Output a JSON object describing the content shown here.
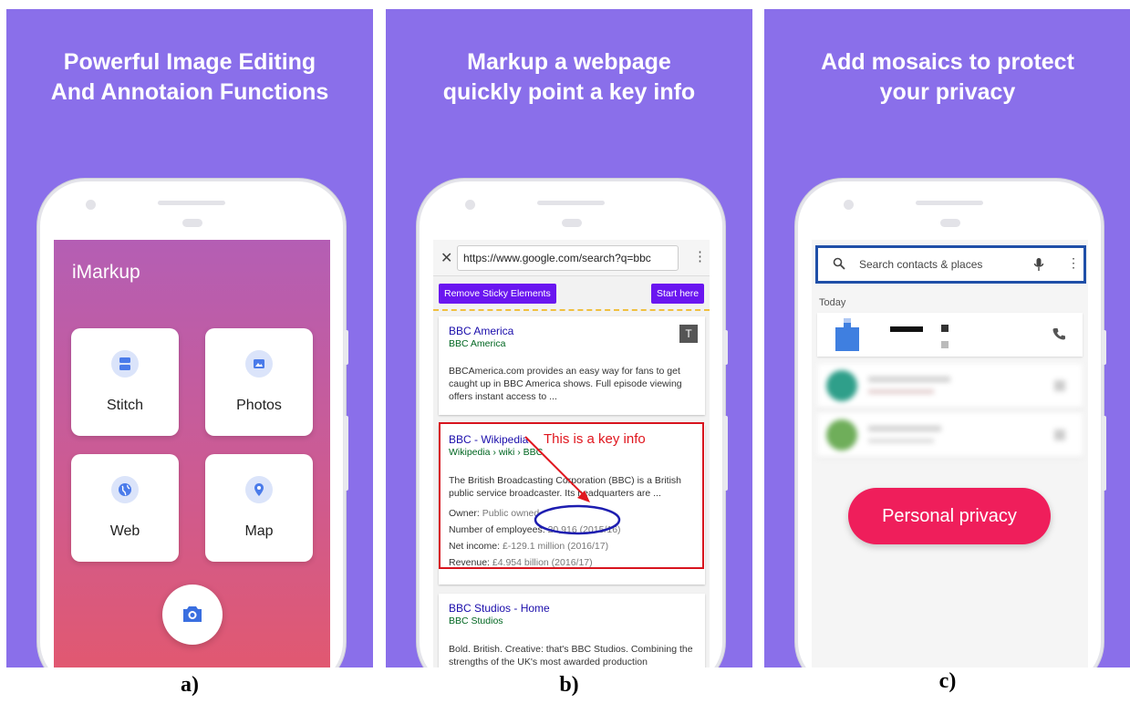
{
  "panels": [
    {
      "heading_line1": "Powerful Image Editing",
      "heading_line2": "And Annotaion Functions",
      "caption": "a)"
    },
    {
      "heading_line1": "Markup a webpage",
      "heading_line2": "quickly point a key info",
      "caption": "b)"
    },
    {
      "heading_line1": "Add mosaics to protect",
      "heading_line2": "your privacy",
      "caption": "c)"
    }
  ],
  "imarkup": {
    "app_title": "iMarkup",
    "tiles": [
      {
        "label": "Stitch",
        "icon": "stitch-icon"
      },
      {
        "label": "Photos",
        "icon": "image-icon"
      },
      {
        "label": "Web",
        "icon": "globe-icon"
      },
      {
        "label": "Map",
        "icon": "map-pin-icon"
      }
    ],
    "camera_icon": "camera-icon"
  },
  "browser": {
    "url": "https://www.google.com/search?q=bbc",
    "remove_sticky": "Remove Sticky Elements",
    "start_here": "Start here",
    "results": [
      {
        "title": "BBC America",
        "source": "BBC America",
        "desc": "BBCAmerica.com provides an easy way for fans to get caught up in BBC America shows. Full episode viewing offers instant access to ...",
        "button": "T"
      },
      {
        "title": "BBC - Wikipedia",
        "source": "Wikipedia › wiki › BBC",
        "desc": "The British Broadcasting Corporation (BBC) is a British public service broadcaster. Its headquarters are ...",
        "facts": [
          {
            "label": "Owner:",
            "value": "Public owned"
          },
          {
            "label": "Number of employees:",
            "value": "20,916 (2015/16)"
          },
          {
            "label": "Net income:",
            "value": "£-129.1 million (2016/17)"
          },
          {
            "label": "Revenue:",
            "value": "£4.954 billion (2016/17)"
          }
        ]
      },
      {
        "title": "BBC Studios - Home",
        "source": "BBC Studios",
        "desc": "Bold. British. Creative: that's BBC Studios. Combining the strengths of the UK's most awarded production"
      }
    ],
    "annotation": "This is a key info",
    "annotation_color": "#e0161e"
  },
  "contacts": {
    "search_placeholder": "Search contacts & places",
    "section": "Today",
    "privacy_button": "Personal privacy",
    "privacy_color": "#ef1e5b"
  },
  "colors": {
    "background": "#8a6fea",
    "accent": "#6a16f0"
  }
}
